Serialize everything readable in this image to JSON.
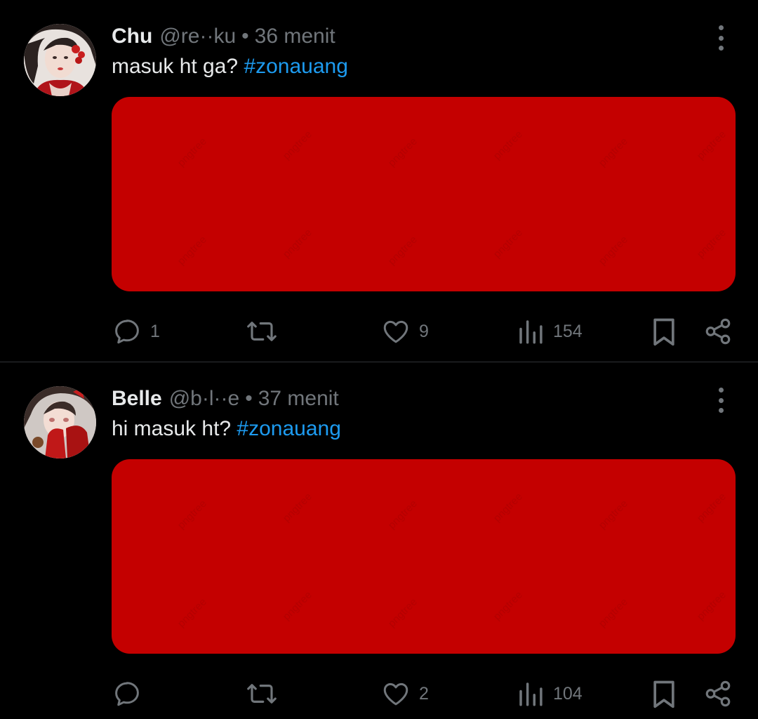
{
  "colors": {
    "background": "#000000",
    "primary_text": "#e7e9ea",
    "secondary_text": "#71767b",
    "hashtag": "#1d9bf0",
    "divider": "#2f3336",
    "media_red": "#c40000"
  },
  "tweets": [
    {
      "name": "Chu",
      "handle": "@re··ku",
      "separator": "•",
      "time": "36 menit",
      "text": "masuk ht ga? ",
      "hashtag": "#zonauang",
      "media_watermark": "pngtree",
      "actions": {
        "reply_count": "1",
        "retweet_count": "",
        "like_count": "9",
        "views_count": "154"
      },
      "icons": [
        "reply-icon",
        "retweet-icon",
        "like-icon",
        "views-icon",
        "bookmark-icon",
        "share-icon",
        "more-icon"
      ]
    },
    {
      "name": "Belle",
      "handle": "@b·l··e",
      "separator": "•",
      "time": "37 menit",
      "text": "hi masuk ht? ",
      "hashtag": "#zonauang",
      "media_watermark": "pngtree",
      "actions": {
        "reply_count": "",
        "retweet_count": "",
        "like_count": "2",
        "views_count": "104"
      },
      "icons": [
        "reply-icon",
        "retweet-icon",
        "like-icon",
        "views-icon",
        "bookmark-icon",
        "share-icon",
        "more-icon"
      ]
    }
  ]
}
